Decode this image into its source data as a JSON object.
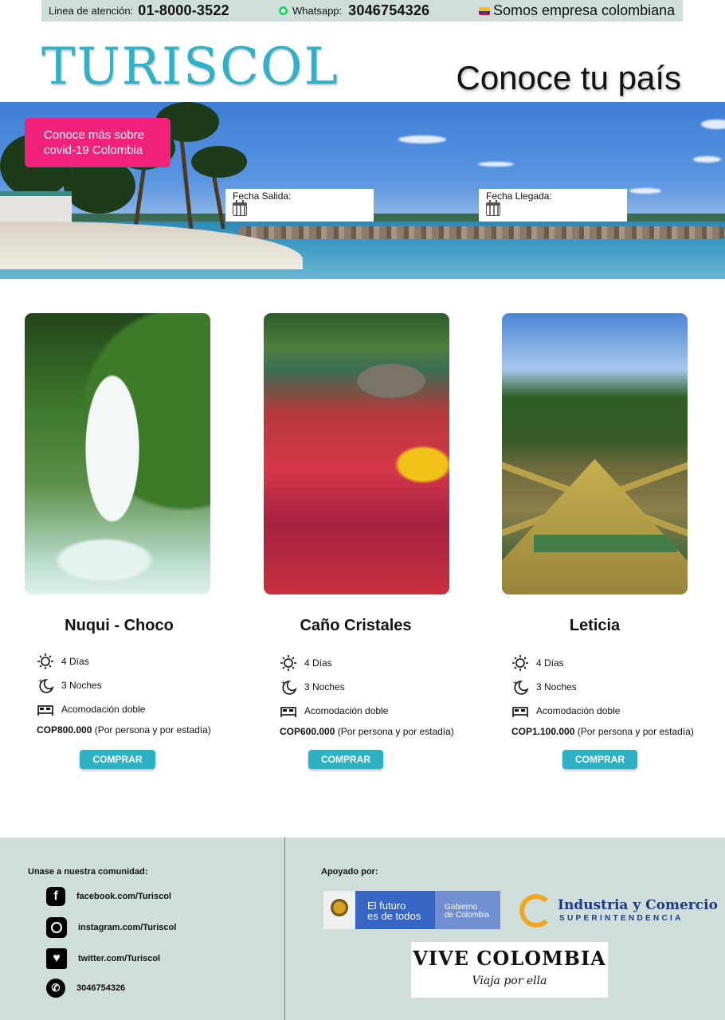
{
  "topbar": {
    "phone_label": "Linea de atención:",
    "phone_number": "01-8000-3522",
    "whatsapp_label": "Whatsapp:",
    "whatsapp_number": "3046754326",
    "tagline": "Somos empresa colombiana"
  },
  "header": {
    "logo": "TURISCOL",
    "slogan": "Conoce tu país"
  },
  "hero": {
    "covid_button": "Conoce más sobre covid-19 Colombia",
    "departure_label": "Fecha Salida:",
    "arrival_label": "Fecha Llegada:"
  },
  "cards": [
    {
      "title": "Nuqui - Choco",
      "days": "4 Días",
      "nights": "3 Noches",
      "room": "Acomodación doble",
      "price": "COP800.000",
      "price_note": " (Por persona y por estadía)",
      "button": "COMPRAR"
    },
    {
      "title": "Caño Cristales",
      "days": "4 Días",
      "nights": "3 Noches",
      "room": "Acomodación doble",
      "price": "COP600.000",
      "price_note": " (Por persona y por estadía)",
      "button": "COMPRAR"
    },
    {
      "title": "Leticia",
      "days": "4 Días",
      "nights": "3 Noches",
      "room": "Acomodación doble",
      "price": "COP1.100.000",
      "price_note": " (Por persona y por estadía)",
      "button": "COMPRAR"
    }
  ],
  "footer": {
    "community_title": "Unase a nuestra comunidad:",
    "facebook": "facebook.com/Turiscol",
    "instagram": "instagram.com/Turiscol",
    "twitter": "twitter.com/Turiscol",
    "whatsapp": "3046754326",
    "support_title": "Apoyado por:",
    "gov_line1": "El futuro",
    "gov_line2": "es de todos",
    "gov_right1": "Gobierno",
    "gov_right2": "de Colombia",
    "sic_line1": "Industria y Comercio",
    "sic_line2": "SUPERINTENDENCIA",
    "vive_line1": "VIVE COLOMBIA",
    "vive_line2": "Viaja por ella"
  },
  "colors": {
    "accent": "#2fb2c8",
    "covid": "#f2217a",
    "footer_bg": "#cfdedb"
  }
}
